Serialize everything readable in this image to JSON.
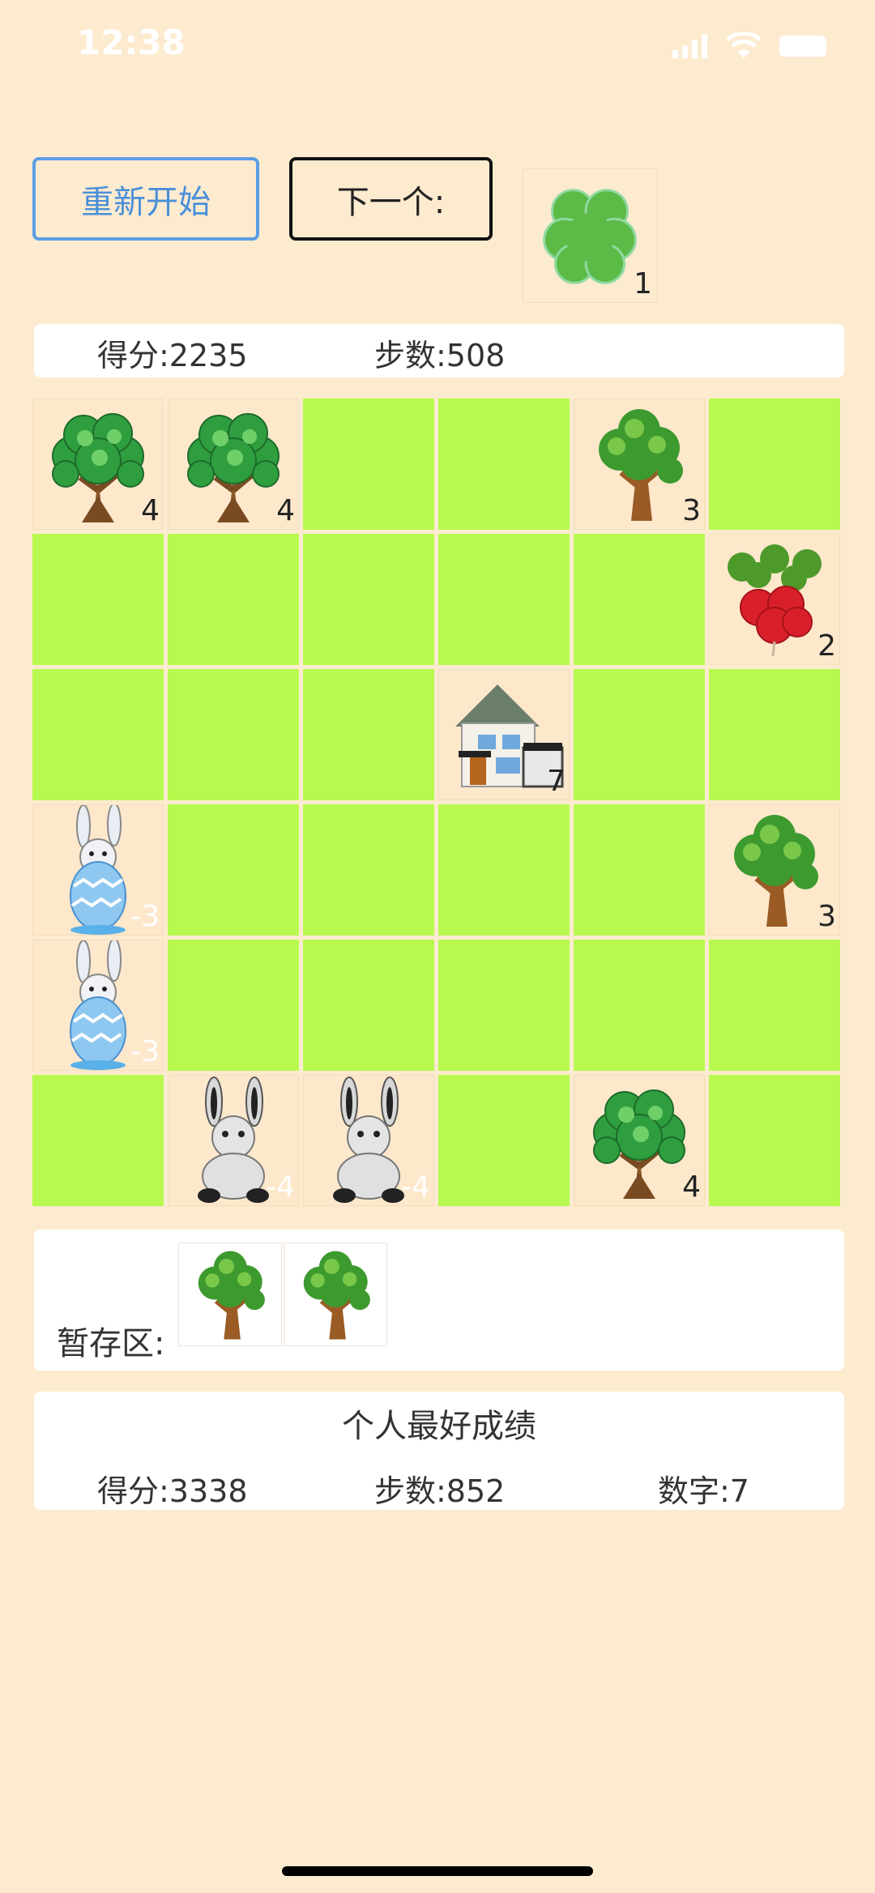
{
  "theme": {
    "background": "#fdebd0",
    "grass": "#b8f94f",
    "accent_blue": "#4a8fd8"
  },
  "status_bar": {
    "time": "12:38"
  },
  "controls": {
    "restart_label": "重新开始",
    "next_label": "下一个:"
  },
  "next_item": {
    "icon": "clover-icon",
    "number": "1"
  },
  "score": {
    "score_label": "得分:2235",
    "steps_label": "步数:508"
  },
  "board": {
    "rows": 6,
    "cols": 6,
    "cells": [
      {
        "type": "bush-tree",
        "number": "4"
      },
      {
        "type": "bush-tree",
        "number": "4"
      },
      {
        "type": "empty"
      },
      {
        "type": "empty"
      },
      {
        "type": "tree",
        "number": "3"
      },
      {
        "type": "empty"
      },
      {
        "type": "empty"
      },
      {
        "type": "empty"
      },
      {
        "type": "empty"
      },
      {
        "type": "empty"
      },
      {
        "type": "empty"
      },
      {
        "type": "radish",
        "number": "2"
      },
      {
        "type": "empty"
      },
      {
        "type": "empty"
      },
      {
        "type": "empty"
      },
      {
        "type": "house",
        "number": "7"
      },
      {
        "type": "empty"
      },
      {
        "type": "empty"
      },
      {
        "type": "egg-bunny",
        "number": "-3"
      },
      {
        "type": "empty"
      },
      {
        "type": "empty"
      },
      {
        "type": "empty"
      },
      {
        "type": "empty"
      },
      {
        "type": "tree",
        "number": "3"
      },
      {
        "type": "egg-bunny",
        "number": "-3"
      },
      {
        "type": "empty"
      },
      {
        "type": "empty"
      },
      {
        "type": "empty"
      },
      {
        "type": "empty"
      },
      {
        "type": "empty"
      },
      {
        "type": "empty"
      },
      {
        "type": "sitting-bunny",
        "number": "-4"
      },
      {
        "type": "sitting-bunny",
        "number": "-4"
      },
      {
        "type": "empty"
      },
      {
        "type": "bush-tree",
        "number": "4"
      },
      {
        "type": "empty"
      }
    ]
  },
  "storage": {
    "label": "暂存区:",
    "items": [
      {
        "type": "tree"
      },
      {
        "type": "tree"
      }
    ]
  },
  "best": {
    "title": "个人最好成绩",
    "score_label": "得分:3338",
    "steps_label": "步数:852",
    "number_label": "数字:7"
  }
}
